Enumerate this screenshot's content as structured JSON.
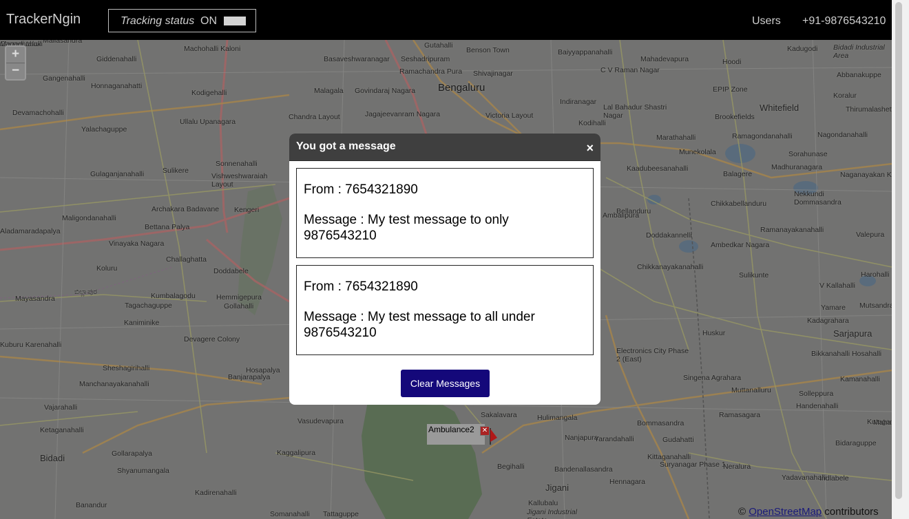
{
  "topbar": {
    "brand": "TrackerNgin",
    "tracking_label": "Tracking status",
    "tracking_value": "ON",
    "nav_users": "Users",
    "nav_phone": "+91-9876543210"
  },
  "map": {
    "zoom_in": "+",
    "zoom_out": "−",
    "places": [
      {
        "name": "Mallasandra",
        "c": "place"
      },
      {
        "name": "Machohalli Kaloni",
        "c": "place"
      },
      {
        "name": "Giddenahalli",
        "c": "place"
      },
      {
        "name": "Gangenahalli",
        "c": "place"
      },
      {
        "name": "Honnaganahatti",
        "c": "place"
      },
      {
        "name": "Kodigehalli",
        "c": "place"
      },
      {
        "name": "Devamachohalli",
        "c": "place"
      },
      {
        "name": "Yalachaguppe",
        "c": "place"
      },
      {
        "name": "Ullalu Upanagara",
        "c": "place"
      },
      {
        "name": "Sulikere",
        "c": "place"
      },
      {
        "name": "Gulaganjanahalli",
        "c": "place"
      },
      {
        "name": "Sonnenahalli",
        "c": "place"
      },
      {
        "name": "Vishweshwaraiah Layout",
        "c": "place"
      },
      {
        "name": "Archakara Badavane",
        "c": "place"
      },
      {
        "name": "Kengeri",
        "c": "place"
      },
      {
        "name": "Maligondanahalli",
        "c": "place"
      },
      {
        "name": "Aladamaradapalya",
        "c": "place"
      },
      {
        "name": "Bettana Palya",
        "c": "place"
      },
      {
        "name": "Vinayaka Nagara",
        "c": "place"
      },
      {
        "name": "Challaghatta",
        "c": "place"
      },
      {
        "name": "Koluru",
        "c": "place"
      },
      {
        "name": "Doddabele",
        "c": "place"
      },
      {
        "name": "Mayasandra",
        "c": "place"
      },
      {
        "name": "Kumbalagodu",
        "c": "place"
      },
      {
        "name": "Hemmigepura",
        "c": "place"
      },
      {
        "name": "Gollahalli",
        "c": "place"
      },
      {
        "name": "Tagachaguppe",
        "c": "place"
      },
      {
        "name": "Kaniminike",
        "c": "place"
      },
      {
        "name": "Devagere Colony",
        "c": "place"
      },
      {
        "name": "Kuburu Karenahalli",
        "c": "place"
      },
      {
        "name": "Sheshagirihalli",
        "c": "place"
      },
      {
        "name": "Hosapalya",
        "c": "place"
      },
      {
        "name": "Manchanayakanahalli",
        "c": "place"
      },
      {
        "name": "Banjarapalya",
        "c": "place"
      },
      {
        "name": "Vajarahalli",
        "c": "place"
      },
      {
        "name": "Ketaganahalli",
        "c": "place"
      },
      {
        "name": "Vasudevapura",
        "c": "place"
      },
      {
        "name": "Bidadi",
        "c": "place big"
      },
      {
        "name": "Gollarapalya",
        "c": "place"
      },
      {
        "name": "Kaggalipura",
        "c": "place"
      },
      {
        "name": "Shyanumangala",
        "c": "place"
      },
      {
        "name": "Kadirenahalli",
        "c": "place"
      },
      {
        "name": "Banandur",
        "c": "place"
      },
      {
        "name": "Somanahalli",
        "c": "place"
      },
      {
        "name": "Tattaguppe",
        "c": "place"
      },
      {
        "name": "Gutahalli",
        "c": "place"
      },
      {
        "name": "Benson Town",
        "c": "place"
      },
      {
        "name": "Baiyyappanahalli",
        "c": "place"
      },
      {
        "name": "Kadugodi",
        "c": "place"
      },
      {
        "name": "Basaveshwaranagar",
        "c": "place"
      },
      {
        "name": "Seshadripuram",
        "c": "place"
      },
      {
        "name": "Mahadevapura",
        "c": "place"
      },
      {
        "name": "Hoodi",
        "c": "place"
      },
      {
        "name": "Ramachandra Pura",
        "c": "place"
      },
      {
        "name": "Shivajinagar",
        "c": "place"
      },
      {
        "name": "C V Raman Nagar",
        "c": "place"
      },
      {
        "name": "Malagala",
        "c": "place"
      },
      {
        "name": "Govindaraj Nagara",
        "c": "place"
      },
      {
        "name": "Bengaluru",
        "c": "place city"
      },
      {
        "name": "EPIP Zone",
        "c": "place"
      },
      {
        "name": "Whitefield",
        "c": "place big"
      },
      {
        "name": "Indiranagar",
        "c": "place"
      },
      {
        "name": "Lal Bahadur Shastri Nagar",
        "c": "place"
      },
      {
        "name": "Brookefields",
        "c": "place"
      },
      {
        "name": "Chandra Layout",
        "c": "place"
      },
      {
        "name": "Jagajeevanram Nagara",
        "c": "place"
      },
      {
        "name": "Victoria Layout",
        "c": "place"
      },
      {
        "name": "Kodihalli",
        "c": "place"
      },
      {
        "name": "Marathahalli",
        "c": "place"
      },
      {
        "name": "Ramagondanahalli",
        "c": "place"
      },
      {
        "name": "Munekolala",
        "c": "place"
      },
      {
        "name": "Kaadubeesanahalli",
        "c": "place"
      },
      {
        "name": "Sorahunase",
        "c": "place"
      },
      {
        "name": "Madhuranagara",
        "c": "place"
      },
      {
        "name": "Balagere",
        "c": "place"
      },
      {
        "name": "Bellanduru",
        "c": "place"
      },
      {
        "name": "Nekkundi Dommasandra",
        "c": "place"
      },
      {
        "name": "Chikkabellanduru",
        "c": "place"
      },
      {
        "name": "Ambalipura",
        "c": "place"
      },
      {
        "name": "Ramanayakanahalli",
        "c": "place"
      },
      {
        "name": "Doddakannelli",
        "c": "place"
      },
      {
        "name": "Ambedkar Nagara",
        "c": "place"
      },
      {
        "name": "Chikkanayakanahalli",
        "c": "place"
      },
      {
        "name": "Sulikunte",
        "c": "place"
      },
      {
        "name": "V Kallahalli",
        "c": "place"
      },
      {
        "name": "Yamare",
        "c": "place"
      },
      {
        "name": "Kadagrahara",
        "c": "place"
      },
      {
        "name": "Sarjapura",
        "c": "place big"
      },
      {
        "name": "Huskur",
        "c": "place"
      },
      {
        "name": "Electronics City Phase 2 (East)",
        "c": "place"
      },
      {
        "name": "Bikkanahalli Hosahalli",
        "c": "place"
      },
      {
        "name": "Singena Agrahara",
        "c": "place"
      },
      {
        "name": "Muttanalluru",
        "c": "place"
      },
      {
        "name": "Solleppura",
        "c": "place"
      },
      {
        "name": "Handenahalli",
        "c": "place"
      },
      {
        "name": "Ramasagara",
        "c": "place"
      },
      {
        "name": "Bommasandra",
        "c": "place"
      },
      {
        "name": "Sakalavara",
        "c": "place"
      },
      {
        "name": "Hulimangala",
        "c": "place"
      },
      {
        "name": "Nanjapura",
        "c": "place"
      },
      {
        "name": "Yarandahalli",
        "c": "place"
      },
      {
        "name": "Kittaganahalli",
        "c": "place"
      },
      {
        "name": "Gudahatti",
        "c": "place"
      },
      {
        "name": "Bidaraguppe",
        "c": "place"
      },
      {
        "name": "Begihalli",
        "c": "place"
      },
      {
        "name": "Bandenallasandra",
        "c": "place"
      },
      {
        "name": "Suryanagar Phase 1",
        "c": "place"
      },
      {
        "name": "Neralura",
        "c": "place"
      },
      {
        "name": "Jigani",
        "c": "place big"
      },
      {
        "name": "Hennagara",
        "c": "place"
      },
      {
        "name": "Yadavanahalli",
        "c": "place"
      },
      {
        "name": "Indlabele",
        "c": "place"
      },
      {
        "name": "Jigani Industrial Estate",
        "c": "place ital"
      },
      {
        "name": "Kallubalu",
        "c": "place"
      },
      {
        "name": "Bidadi Industrial Area",
        "c": "place ital"
      },
      {
        "name": "Abbanakuppe",
        "c": "place"
      },
      {
        "name": "Koralur",
        "c": "place"
      },
      {
        "name": "Thirumalashettihalli",
        "c": "place"
      },
      {
        "name": "Nagondanahalli",
        "c": "place"
      },
      {
        "name": "Naganayakan Kote",
        "c": "place"
      },
      {
        "name": "Valepura",
        "c": "place"
      },
      {
        "name": "Harohalli",
        "c": "place"
      },
      {
        "name": "Mutsandra",
        "c": "place"
      },
      {
        "name": "Kamanahalli",
        "c": "place"
      },
      {
        "name": "Kutagan",
        "c": "place"
      },
      {
        "name": "Mahal Ch",
        "c": "place"
      },
      {
        "name": "ಬಿಲ್ಲಾಪುರ",
        "c": "place"
      },
      {
        "name": "Gangenahalli",
        "c": "place"
      },
      {
        "name": "Magadi taluk",
        "c": "place ital"
      }
    ],
    "marker_label": "Ambulance2",
    "marker_x": "✕",
    "attribution_prefix": "© ",
    "attribution_link": "OpenStreetMap",
    "attribution_suffix": " contributors"
  },
  "modal": {
    "title": "You got a message",
    "close": "×",
    "messages": [
      {
        "from": "From : 7654321890",
        "body": "Message : My test message to only 9876543210"
      },
      {
        "from": "From : 7654321890",
        "body": "Message : My test message to all under 9876543210"
      }
    ],
    "clear_button": "Clear Messages"
  },
  "colors": {
    "topbar_bg": "#000000",
    "modal_header_bg": "#3f3f3f",
    "button_bg": "#14087a"
  }
}
